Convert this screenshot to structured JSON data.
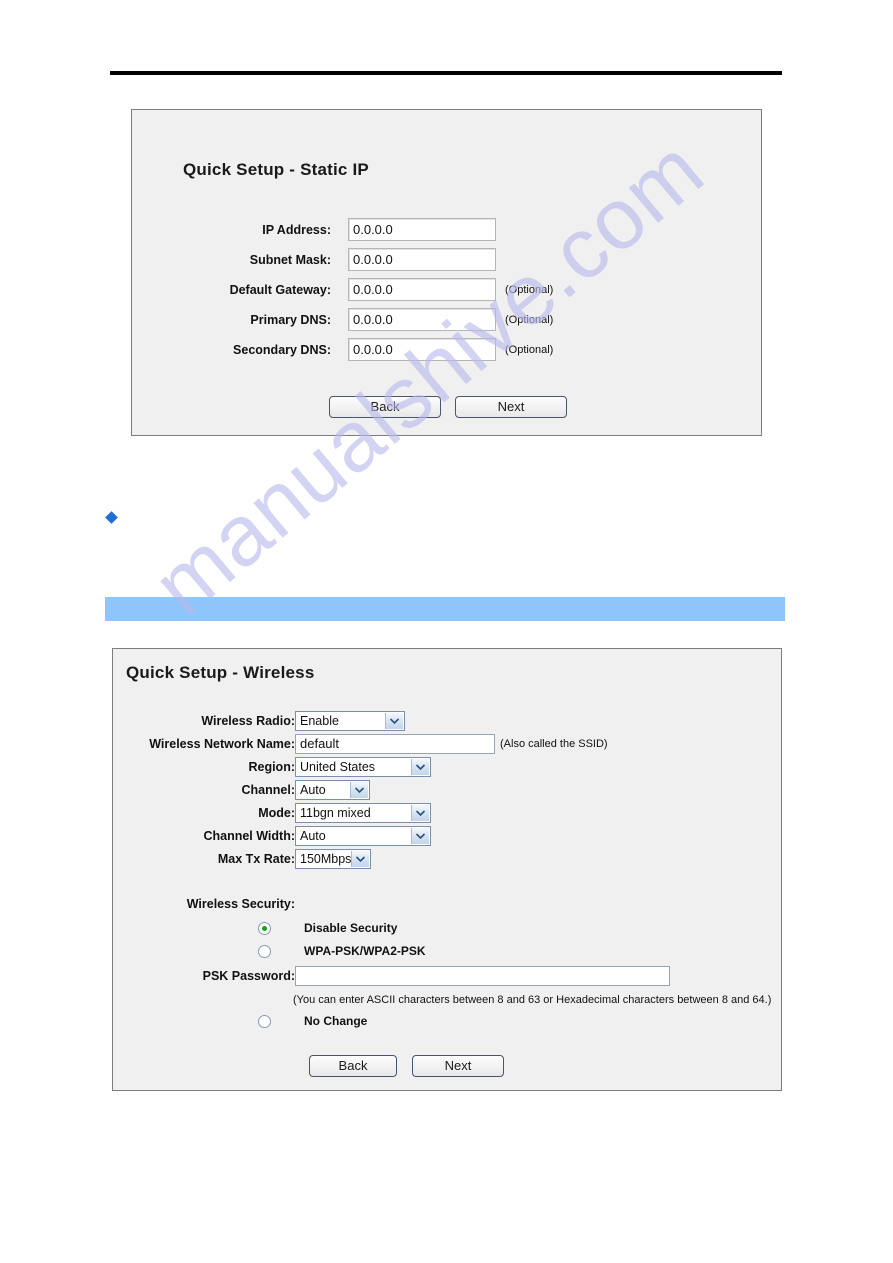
{
  "document": {
    "watermark_text": "manualshive.com",
    "bullet_marker": "diamond-bullet",
    "blue_highlight_bar": ""
  },
  "static_ip_panel": {
    "title": "Quick Setup - Static IP",
    "fields": [
      {
        "label": "IP Address:",
        "value": "0.0.0.0",
        "note": ""
      },
      {
        "label": "Subnet Mask:",
        "value": "0.0.0.0",
        "note": ""
      },
      {
        "label": "Default Gateway:",
        "value": "0.0.0.0",
        "note": "(Optional)"
      },
      {
        "label": "Primary DNS:",
        "value": "0.0.0.0",
        "note": "(Optional)"
      },
      {
        "label": "Secondary DNS:",
        "value": "0.0.0.0",
        "note": "(Optional)"
      }
    ],
    "buttons": {
      "back": "Back",
      "next": "Next"
    }
  },
  "wireless_panel": {
    "title": "Quick Setup - Wireless",
    "fields": {
      "wireless_radio": {
        "label": "Wireless Radio:",
        "value": "Enable"
      },
      "network_name": {
        "label": "Wireless Network Name:",
        "value": "default",
        "note": "(Also called the SSID)"
      },
      "region": {
        "label": "Region:",
        "value": "United States"
      },
      "channel": {
        "label": "Channel:",
        "value": "Auto"
      },
      "mode": {
        "label": "Mode:",
        "value": "11bgn mixed"
      },
      "channel_width": {
        "label": "Channel Width:",
        "value": "Auto"
      },
      "max_tx_rate": {
        "label": "Max Tx Rate:",
        "value": "150Mbps"
      }
    },
    "security": {
      "label": "Wireless Security:",
      "options": [
        {
          "label": "Disable Security",
          "selected": true
        },
        {
          "label": "WPA-PSK/WPA2-PSK",
          "selected": false
        },
        {
          "label": "No Change",
          "selected": false
        }
      ],
      "psk_label": "PSK Password:",
      "psk_value": "",
      "psk_hint": "(You can enter ASCII characters between 8 and 63 or Hexadecimal characters between 8 and 64.)"
    },
    "buttons": {
      "back": "Back",
      "next": "Next"
    }
  }
}
